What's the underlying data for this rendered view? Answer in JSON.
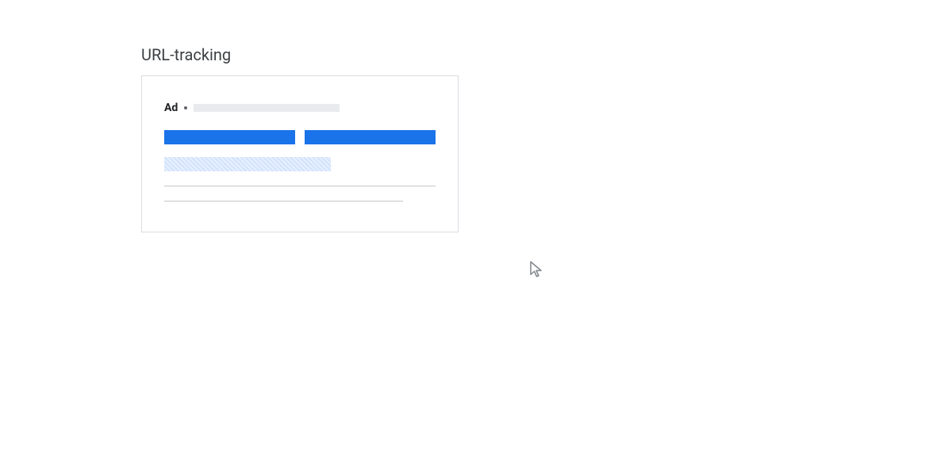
{
  "title": "URL-tracking",
  "ad": {
    "label": "Ad"
  },
  "colors": {
    "headline": "#1a73e8",
    "highlight_pattern_light": "#e8f0fe",
    "highlight_pattern_dark": "#d2e3fc",
    "placeholder": "#e8eaed",
    "border": "#dadce0",
    "text_title": "#3c4043",
    "text_body": "#202124"
  }
}
